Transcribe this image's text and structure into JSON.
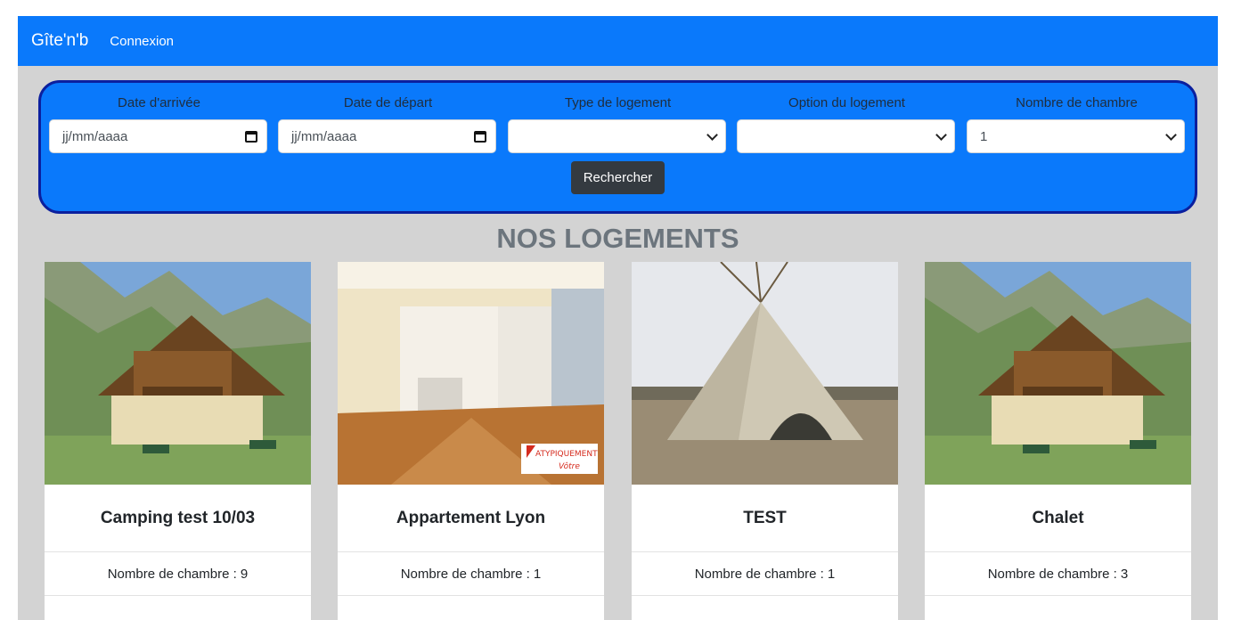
{
  "navbar": {
    "brand": "Gîte'n'b",
    "login_link": "Connexion"
  },
  "search": {
    "arrival_label": "Date d'arrivée",
    "arrival_placeholder": "jj/mm/aaaa",
    "departure_label": "Date de départ",
    "departure_placeholder": "jj/mm/aaaa",
    "type_label": "Type de logement",
    "type_value": "",
    "option_label": "Option du logement",
    "option_value": "",
    "rooms_label": "Nombre de chambre",
    "rooms_value": "1",
    "submit_label": "Rechercher"
  },
  "section": {
    "title": "NOS LOGEMENTS"
  },
  "cards": [
    {
      "title": "Camping test 10/03",
      "rooms": "Nombre de chambre : 9",
      "image": "chalet-photo"
    },
    {
      "title": "Appartement Lyon",
      "rooms": "Nombre de chambre : 1",
      "image": "apartment-photo",
      "watermark": "ATYPIQUEMENT Vôtre"
    },
    {
      "title": "TEST",
      "rooms": "Nombre de chambre : 1",
      "image": "tipi-photo"
    },
    {
      "title": "Chalet",
      "rooms": "Nombre de chambre : 3",
      "image": "chalet-photo"
    }
  ],
  "colors": {
    "primary": "#0a79fb",
    "panel_border": "#0b1f9e",
    "button_dark": "#343a40",
    "background": "#d3d3d3",
    "title_gray": "#6c757d"
  }
}
